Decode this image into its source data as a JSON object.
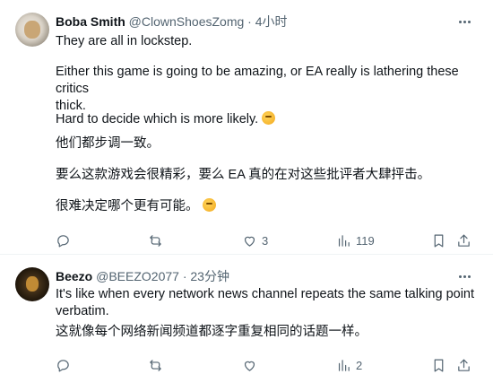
{
  "tweets": [
    {
      "name": "Boba Smith",
      "handle": "@ClownShoesZomg",
      "dot": "·",
      "time": "4小时",
      "lines": [
        "They are all in lockstep.",
        "Either this game is going to be amazing, or EA really is lathering these critics",
        "thick.",
        "Hard to decide which is more likely.",
        "他们都步调一致。",
        "要么这款游戏会很精彩，要么 EA 真的在对这些批评者大肆抨击。",
        "很难决定哪个更有可能。"
      ],
      "emoji_icon": "thinking-face-emoji",
      "likes": "3",
      "views": "119"
    },
    {
      "name": "Beezo",
      "handle": "@BEEZO2077",
      "dot": "·",
      "time": "23分钟",
      "lines": [
        "It's like when every network news channel repeats the same talking point",
        "verbatim.",
        "这就像每个网络新闻频道都逐字重复相同的话题一样。"
      ],
      "views": "2"
    }
  ],
  "colors": {
    "text": "#0f1419",
    "secondary": "#536471",
    "divider": "#eff3f4"
  }
}
